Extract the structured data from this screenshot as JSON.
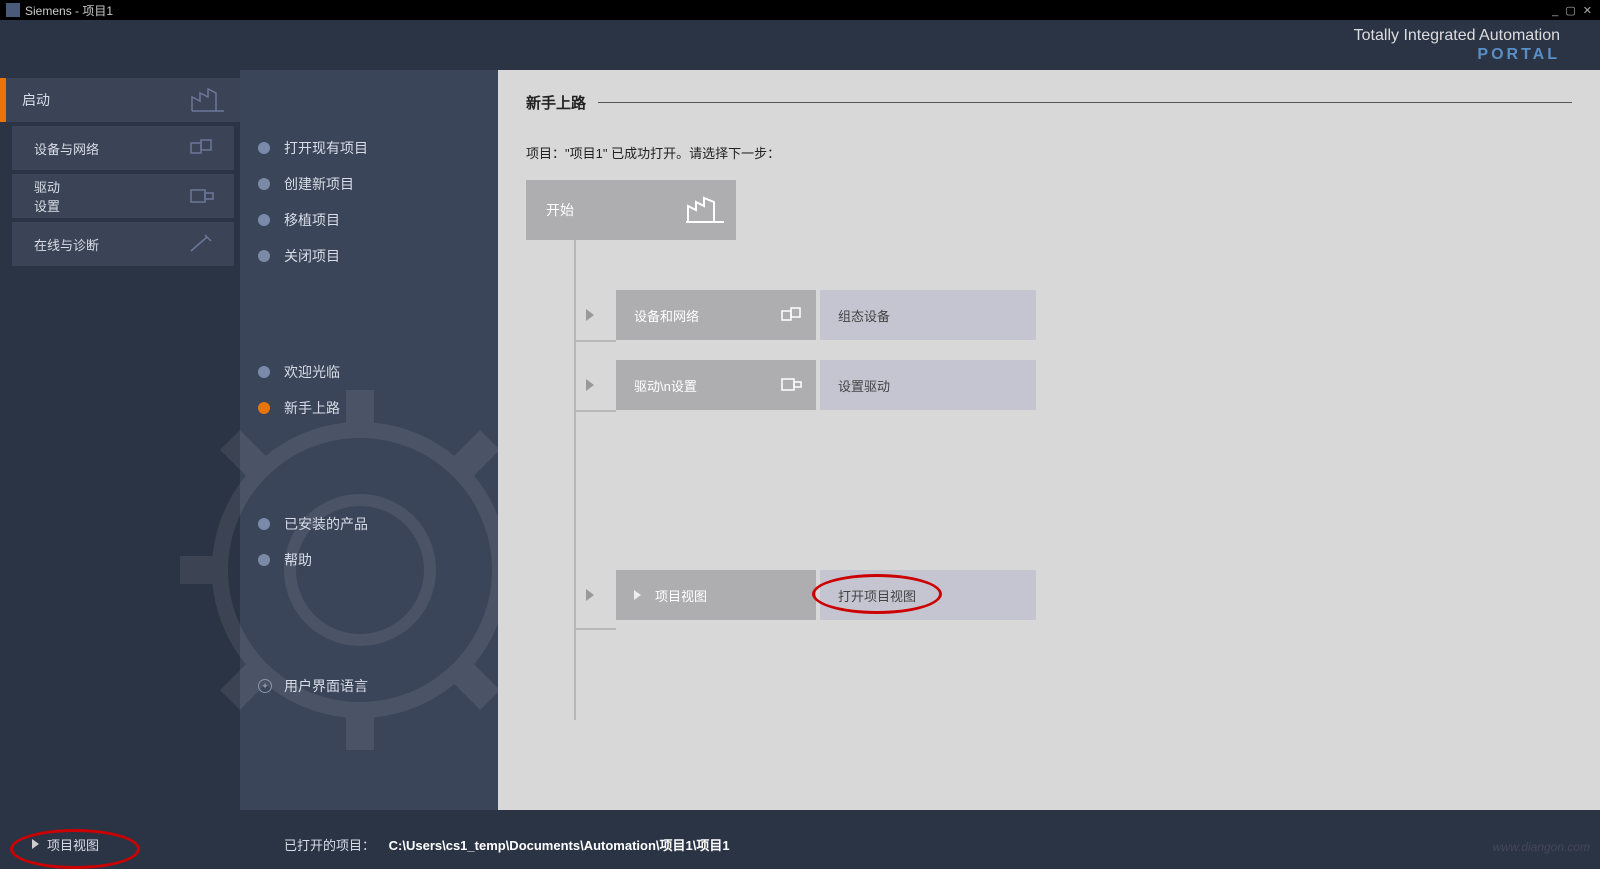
{
  "window": {
    "title": "Siemens  -  项目1",
    "controls": "_ ▢ ✕"
  },
  "brand": {
    "line1": "Totally Integrated Automation",
    "line2": "PORTAL"
  },
  "sidebar_primary": [
    {
      "label": "启动",
      "selected": true,
      "icon": "factory"
    },
    {
      "label": "设备与网络",
      "selected": false,
      "icon": "cubes"
    },
    {
      "label": "驱动\n设置",
      "selected": false,
      "icon": "motor"
    },
    {
      "label": "在线与诊断",
      "selected": false,
      "icon": "wrench"
    }
  ],
  "sidebar_secondary_top": [
    {
      "label": "打开现有项目",
      "active": false
    },
    {
      "label": "创建新项目",
      "active": false
    },
    {
      "label": "移植项目",
      "active": false
    },
    {
      "label": "关闭项目",
      "active": false
    }
  ],
  "sidebar_secondary_mid": [
    {
      "label": "欢迎光临",
      "active": false
    },
    {
      "label": "新手上路",
      "active": true
    }
  ],
  "sidebar_secondary_bot": [
    {
      "label": "已安装的产品",
      "active": false
    },
    {
      "label": "帮助",
      "active": false
    }
  ],
  "sidebar_secondary_lang": {
    "label": "用户界面语言"
  },
  "content": {
    "title": "新手上路",
    "project_message": "项目：\"项目1\" 已成功打开。请选择下一步：",
    "flow_start": "开始",
    "flow_rows": [
      {
        "a": "设备和网络",
        "b": "组态设备",
        "icon": "cubes"
      },
      {
        "a": "驱动\\n设置",
        "b": "设置驱动",
        "icon": "motor"
      }
    ],
    "flow_last": {
      "a": "项目视图",
      "b": "打开项目视图"
    }
  },
  "footer": {
    "left": "项目视图",
    "center_label": "已打开的项目：",
    "path": "C:\\Users\\cs1_temp\\Documents\\Automation\\项目1\\项目1"
  },
  "watermark": "www.diangon.com"
}
